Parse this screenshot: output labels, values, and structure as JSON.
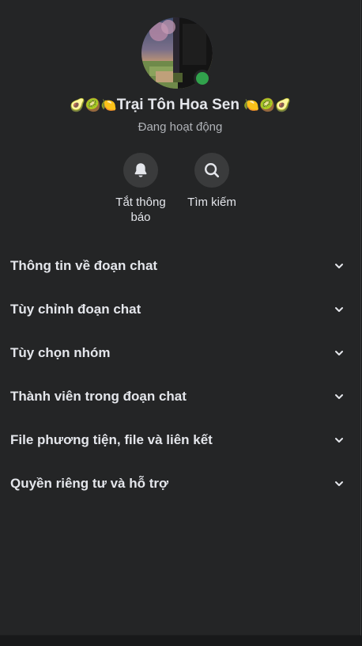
{
  "conversation": {
    "title_emoji_left": "🥑🥝🍋",
    "title": "Trại Tôn Hoa Sen",
    "title_emoji_right": "🍋🥝🥑",
    "status": "Đang hoạt động",
    "online_color": "#31a24c"
  },
  "actions": [
    {
      "icon": "bell-icon",
      "label_line1": "Tắt thông",
      "label_line2": "báo"
    },
    {
      "icon": "search-icon",
      "label_line1": "Tìm kiếm"
    }
  ],
  "menu": [
    {
      "label": "Thông tin về đoạn chat",
      "icon": "chevron-down-icon"
    },
    {
      "label": "Tùy chỉnh đoạn chat",
      "icon": "chevron-down-icon"
    },
    {
      "label": "Tùy chọn nhóm",
      "icon": "chevron-down-icon"
    },
    {
      "label": "Thành viên trong đoạn chat",
      "icon": "chevron-down-icon"
    },
    {
      "label": "File phương tiện, file và liên kết",
      "icon": "chevron-down-icon"
    },
    {
      "label": "Quyền riêng tư và hỗ trợ",
      "icon": "chevron-down-icon"
    }
  ],
  "theme": {
    "panel_bg": "#242526",
    "page_bg": "#18191a",
    "button_bg": "#3a3b3c",
    "text_primary": "#e4e6eb",
    "text_secondary": "#b0b3b8"
  }
}
